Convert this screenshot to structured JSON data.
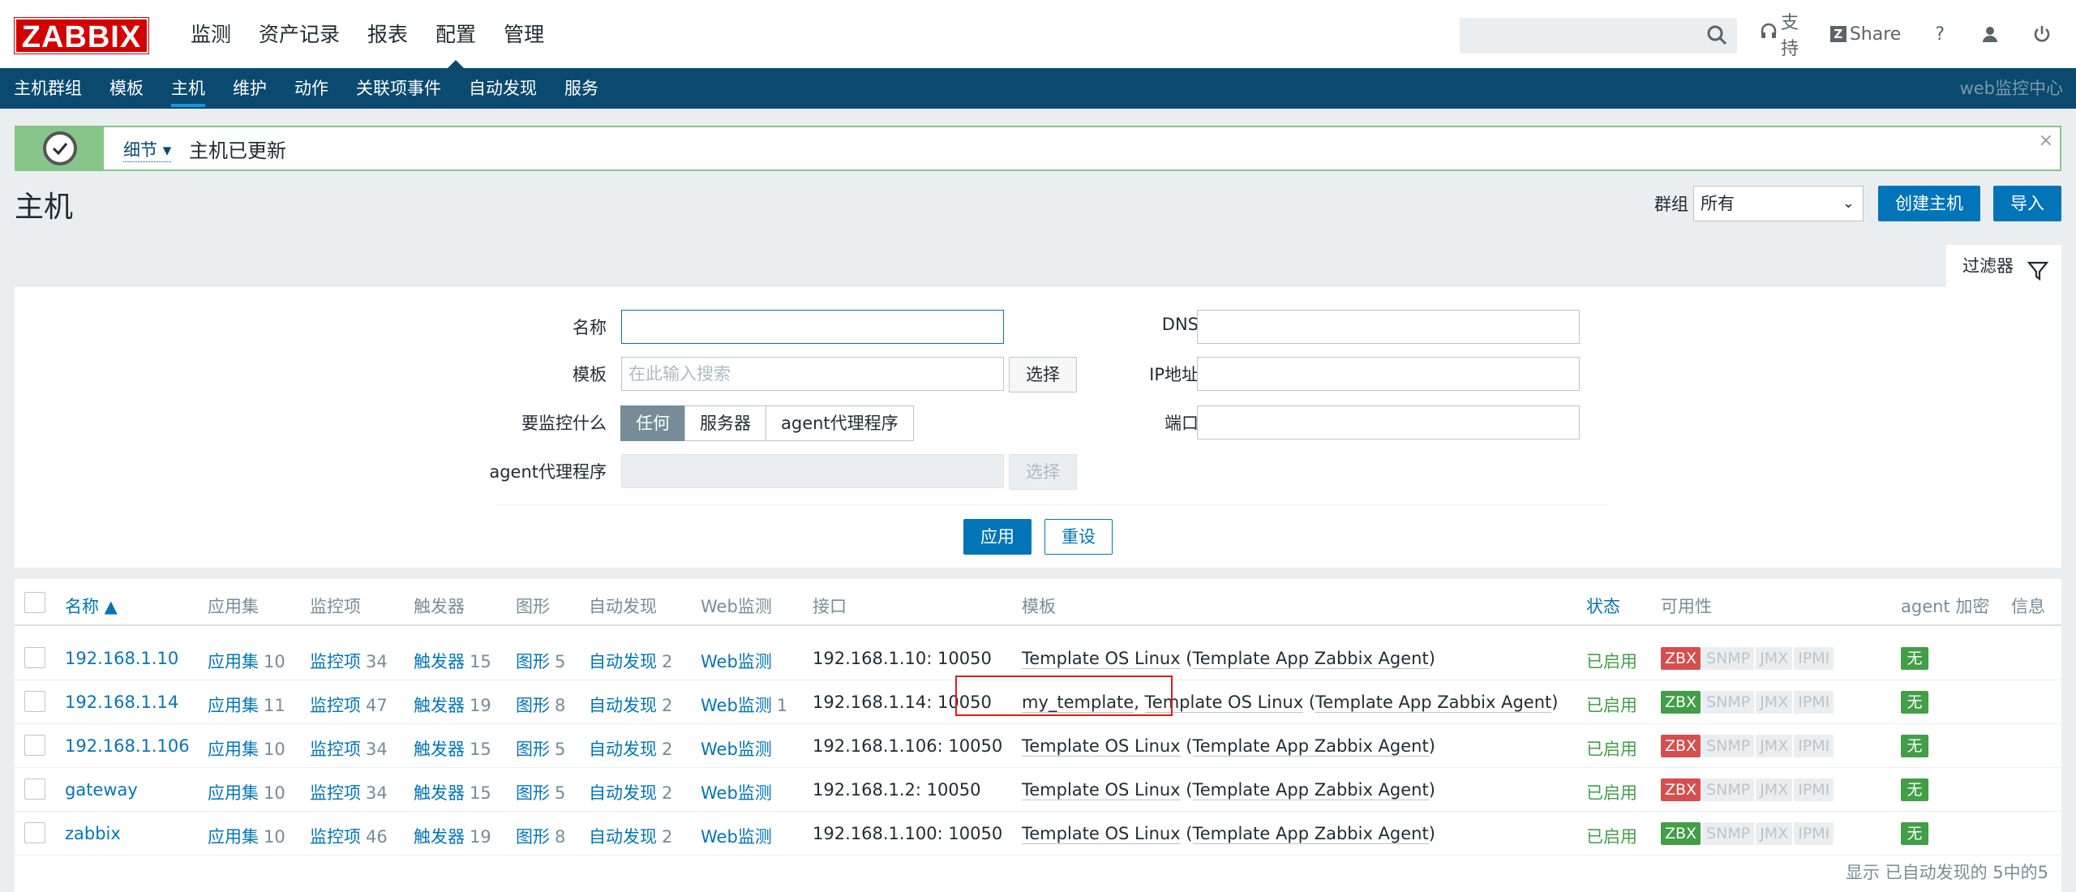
{
  "brand": {
    "logo": "ZABBIX",
    "brand_color": "#d40000"
  },
  "main_menu": [
    "监测",
    "资产记录",
    "报表",
    "配置",
    "管理"
  ],
  "main_menu_active": "配置",
  "top_icons": [
    {
      "icon": "search-icon"
    },
    {
      "icon": "headset-icon",
      "label": "支持"
    },
    {
      "icon": "share-icon",
      "label": "Share"
    },
    {
      "icon": "help-icon",
      "label": "?"
    },
    {
      "icon": "user-icon"
    },
    {
      "icon": "power-icon"
    }
  ],
  "sub_menu": [
    "主机群组",
    "模板",
    "主机",
    "维护",
    "动作",
    "关联项事件",
    "自动发现",
    "服务"
  ],
  "sub_menu_active": "主机",
  "sub_right": "web监控中心",
  "message": {
    "details": "细节",
    "text": "主机已更新",
    "close": "×"
  },
  "page": {
    "title": "主机",
    "group_label": "群组",
    "group_value": "所有",
    "create_button": "创建主机",
    "import_button": "导入"
  },
  "filter": {
    "tab_label": "过滤器",
    "name_label": "名称",
    "name_value": "",
    "template_label": "模板",
    "template_placeholder": "在此输入搜索",
    "select_button": "选择",
    "monitored_by_label": "要监控什么",
    "monitored_by_options": [
      "任何",
      "服务器",
      "agent代理程序"
    ],
    "monitored_by_selected": "任何",
    "proxy_label": "agent代理程序",
    "proxy_select_button": "选择",
    "dns_label": "DNS",
    "ip_label": "IP地址",
    "port_label": "端口",
    "apply_button": "应用",
    "reset_button": "重设"
  },
  "table": {
    "headers": [
      "名称 ▲",
      "应用集",
      "监控项",
      "触发器",
      "图形",
      "自动发现",
      "Web监测",
      "接口",
      "模板",
      "状态",
      "可用性",
      "agent 加密",
      "信息"
    ],
    "rows": [
      {
        "name": "192.168.1.10",
        "apps": "应用集",
        "apps_n": "10",
        "items": "监控项",
        "items_n": "34",
        "triggers": "触发器",
        "triggers_n": "15",
        "graphs": "图形",
        "graphs_n": "5",
        "discovery": "自动发现",
        "discovery_n": "2",
        "web": "Web监测",
        "web_n": "",
        "interface": "192.168.1.10: 10050",
        "tpl_pre": "",
        "tpl_main": "Template OS Linux",
        "tpl_parent": "Template App Zabbix Agent",
        "status": "已启用",
        "zbx": "red",
        "encryption": "无"
      },
      {
        "name": "192.168.1.14",
        "apps": "应用集",
        "apps_n": "11",
        "items": "监控项",
        "items_n": "47",
        "triggers": "触发器",
        "triggers_n": "19",
        "graphs": "图形",
        "graphs_n": "8",
        "discovery": "自动发现",
        "discovery_n": "2",
        "web": "Web监测",
        "web_n": "1",
        "interface": "192.168.1.14: 10050",
        "tpl_pre": "my_template",
        "tpl_main": "Template OS Linux",
        "tpl_parent": "Template App Zabbix Agent",
        "status": "已启用",
        "zbx": "green",
        "encryption": "无"
      },
      {
        "name": "192.168.1.106",
        "apps": "应用集",
        "apps_n": "10",
        "items": "监控项",
        "items_n": "34",
        "triggers": "触发器",
        "triggers_n": "15",
        "graphs": "图形",
        "graphs_n": "5",
        "discovery": "自动发现",
        "discovery_n": "2",
        "web": "Web监测",
        "web_n": "",
        "interface": "192.168.1.106: 10050",
        "tpl_pre": "",
        "tpl_main": "Template OS Linux",
        "tpl_parent": "Template App Zabbix Agent",
        "status": "已启用",
        "zbx": "red",
        "encryption": "无"
      },
      {
        "name": "gateway",
        "apps": "应用集",
        "apps_n": "10",
        "items": "监控项",
        "items_n": "34",
        "triggers": "触发器",
        "triggers_n": "15",
        "graphs": "图形",
        "graphs_n": "5",
        "discovery": "自动发现",
        "discovery_n": "2",
        "web": "Web监测",
        "web_n": "",
        "interface": "192.168.1.2: 10050",
        "tpl_pre": "",
        "tpl_main": "Template OS Linux",
        "tpl_parent": "Template App Zabbix Agent",
        "status": "已启用",
        "zbx": "red",
        "encryption": "无"
      },
      {
        "name": "zabbix",
        "apps": "应用集",
        "apps_n": "10",
        "items": "监控项",
        "items_n": "46",
        "triggers": "触发器",
        "triggers_n": "19",
        "graphs": "图形",
        "graphs_n": "8",
        "discovery": "自动发现",
        "discovery_n": "2",
        "web": "Web监测",
        "web_n": "",
        "interface": "192.168.1.100: 10050",
        "tpl_pre": "",
        "tpl_main": "Template OS Linux",
        "tpl_parent": "Template App Zabbix Agent",
        "status": "已启用",
        "zbx": "green",
        "encryption": "无"
      }
    ],
    "availability_tags": [
      "ZBX",
      "SNMP",
      "JMX",
      "IPMI"
    ],
    "footer": "显示 已自动发现的 5中的5"
  },
  "colors": {
    "accent": "#0275b8",
    "nav": "#0b4a6f",
    "ok": "#429e47",
    "error": "#d64e4e",
    "highlight": "#e01c1c"
  }
}
